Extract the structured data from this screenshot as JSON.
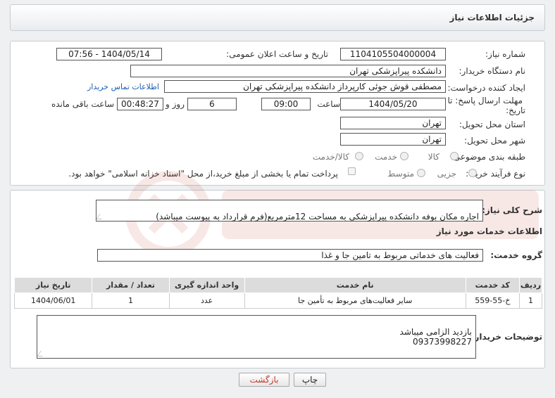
{
  "header": {
    "title": "جزئیات اطلاعات نیاز"
  },
  "form": {
    "need_number_label": "شماره نیاز:",
    "need_number": "1104105504000004",
    "announce_label": "تاریخ و ساعت اعلان عمومی:",
    "announce_value": "1404/05/14 - 07:56",
    "buyer_org_label": "نام دستگاه خریدار:",
    "buyer_org": "دانشکده پیراپزشکی تهران",
    "creator_label": "ایجاد کننده درخواست:",
    "creator": "مصطفی قوش جوئی کارپرداز دانشکده پیراپزشکی تهران",
    "contact_link": "اطلاعات تماس خریدار",
    "deadline_label_1": "مهلت ارسال پاسخ: تا",
    "deadline_label_2": "تاریخ:",
    "deadline_date": "1404/05/20",
    "hour_label": "ساعت",
    "deadline_time": "09:00",
    "days_value": "6",
    "days_label": "روز و",
    "remaining_time": "00:48:27",
    "remaining_label": "ساعت باقی مانده",
    "province_label": "استان محل تحویل:",
    "province": "تهران",
    "city_label": "شهر محل تحویل:",
    "city": "تهران",
    "category_label": "طبقه بندی موضوعی:",
    "category_options": [
      "کالا",
      "خدمت",
      "کالا/خدمت"
    ],
    "process_label": "نوع فرآیند خرید :",
    "process_options": [
      "جزیی",
      "متوسط"
    ],
    "payment_note": "پرداخت تمام یا بخشی از مبلغ خرید،از محل \"اسناد خزانه اسلامی\" خواهد بود."
  },
  "summary": {
    "label": "شرح کلی نیاز:",
    "text": "اجاره مکان بوفه دانشکده پیراپزشکی به مساحت 12مترمربع(فرم قرارداد به پیوست میباشد)"
  },
  "services": {
    "title": "اطلاعات خدمات مورد نیاز",
    "group_label": "گروه خدمت:",
    "group_value": "فعالیت های خدماتی مربوط به تامین جا و غذا",
    "columns": [
      "ردیف",
      "کد خدمت",
      "نام خدمت",
      "واحد اندازه گیری",
      "تعداد / مقدار",
      "تاریخ نیاز"
    ],
    "rows": [
      [
        "1",
        "خ-55-559",
        "سایر فعالیت‌های مربوط به تأمین جا",
        "عدد",
        "1",
        "1404/06/01"
      ]
    ]
  },
  "buyer_notes": {
    "label": "توضیحات خریدار:",
    "text": "بازدید الزامی میباشد\n09373998227"
  },
  "buttons": {
    "print": "چاپ",
    "back": "بازگشت"
  },
  "colors": {
    "link": "#1a5fb4",
    "back_text": "#c0392b",
    "watermark": "#c0392b"
  }
}
